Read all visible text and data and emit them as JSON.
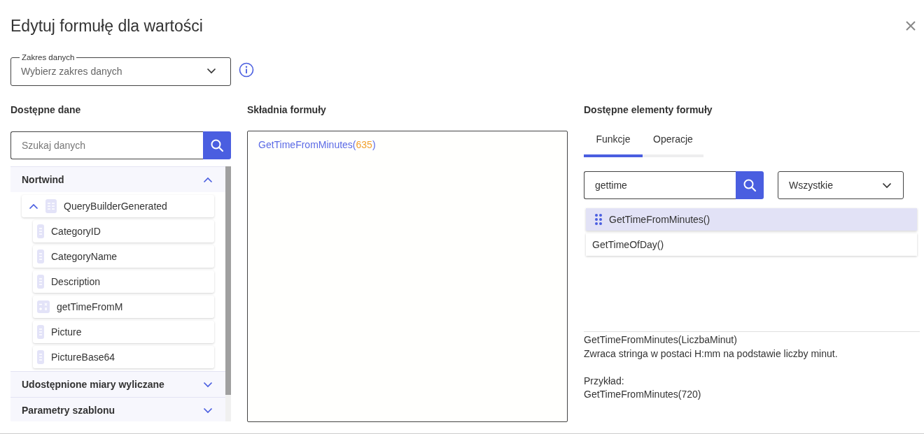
{
  "dialog": {
    "title": "Edytuj formułę dla wartości"
  },
  "data_range": {
    "label": "Zakres danych",
    "placeholder": "Wybierz zakres danych"
  },
  "available_data": {
    "heading": "Dostępne dane",
    "search": {
      "placeholder": "Szukaj danych"
    },
    "sections": [
      {
        "label": "Nortwind",
        "expanded": true,
        "children": [
          {
            "label": "QueryBuilderGenerated",
            "kind": "table",
            "expanded": true,
            "children": [
              {
                "label": "CategoryID",
                "kind": "field"
              },
              {
                "label": "CategoryName",
                "kind": "field"
              },
              {
                "label": "Description",
                "kind": "field"
              },
              {
                "label": "getTimeFromM",
                "kind": "calc"
              },
              {
                "label": "Picture",
                "kind": "field"
              },
              {
                "label": "PictureBase64",
                "kind": "field"
              }
            ]
          }
        ]
      },
      {
        "label": "Udostępnione miary wyliczane",
        "expanded": false
      },
      {
        "label": "Parametry szablonu",
        "expanded": false
      }
    ]
  },
  "formula": {
    "heading": "Składnia formuły",
    "tokens": [
      {
        "text": "GetTimeFromMinutes(",
        "kind": "function"
      },
      {
        "text": "635",
        "kind": "number"
      },
      {
        "text": ")",
        "kind": "function"
      }
    ]
  },
  "elements": {
    "heading": "Dostępne elementy formuły",
    "tabs": [
      {
        "label": "Funkcje",
        "selected": true
      },
      {
        "label": "Operacje",
        "selected": false
      }
    ],
    "search": {
      "value": "gettime"
    },
    "category": {
      "value": "Wszystkie"
    },
    "items": [
      {
        "label": "GetTimeFromMinutes()",
        "selected": true
      },
      {
        "label": "GetTimeOfDay()",
        "selected": false
      }
    ],
    "description": {
      "signature": "GetTimeFromMinutes(LiczbaMinut)",
      "text": "Zwraca stringa w postaci H:mm na podstawie liczby minut.",
      "example_label": "Przykład:",
      "example": "GetTimeFromMinutes(720)"
    }
  }
}
